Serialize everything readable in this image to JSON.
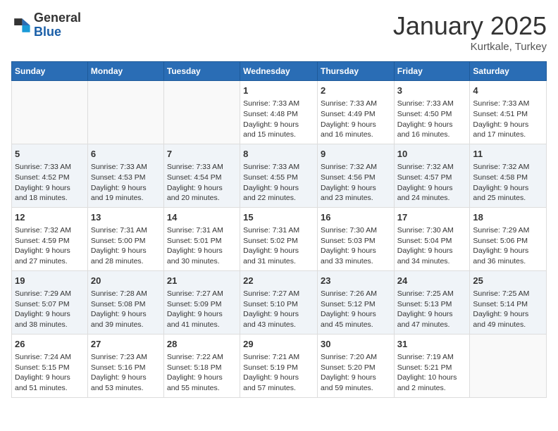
{
  "header": {
    "logo_general": "General",
    "logo_blue": "Blue",
    "month": "January 2025",
    "location": "Kurtkale, Turkey"
  },
  "weekdays": [
    "Sunday",
    "Monday",
    "Tuesday",
    "Wednesday",
    "Thursday",
    "Friday",
    "Saturday"
  ],
  "weeks": [
    [
      {
        "day": "",
        "info": ""
      },
      {
        "day": "",
        "info": ""
      },
      {
        "day": "",
        "info": ""
      },
      {
        "day": "1",
        "info": "Sunrise: 7:33 AM\nSunset: 4:48 PM\nDaylight: 9 hours\nand 15 minutes."
      },
      {
        "day": "2",
        "info": "Sunrise: 7:33 AM\nSunset: 4:49 PM\nDaylight: 9 hours\nand 16 minutes."
      },
      {
        "day": "3",
        "info": "Sunrise: 7:33 AM\nSunset: 4:50 PM\nDaylight: 9 hours\nand 16 minutes."
      },
      {
        "day": "4",
        "info": "Sunrise: 7:33 AM\nSunset: 4:51 PM\nDaylight: 9 hours\nand 17 minutes."
      }
    ],
    [
      {
        "day": "5",
        "info": "Sunrise: 7:33 AM\nSunset: 4:52 PM\nDaylight: 9 hours\nand 18 minutes."
      },
      {
        "day": "6",
        "info": "Sunrise: 7:33 AM\nSunset: 4:53 PM\nDaylight: 9 hours\nand 19 minutes."
      },
      {
        "day": "7",
        "info": "Sunrise: 7:33 AM\nSunset: 4:54 PM\nDaylight: 9 hours\nand 20 minutes."
      },
      {
        "day": "8",
        "info": "Sunrise: 7:33 AM\nSunset: 4:55 PM\nDaylight: 9 hours\nand 22 minutes."
      },
      {
        "day": "9",
        "info": "Sunrise: 7:32 AM\nSunset: 4:56 PM\nDaylight: 9 hours\nand 23 minutes."
      },
      {
        "day": "10",
        "info": "Sunrise: 7:32 AM\nSunset: 4:57 PM\nDaylight: 9 hours\nand 24 minutes."
      },
      {
        "day": "11",
        "info": "Sunrise: 7:32 AM\nSunset: 4:58 PM\nDaylight: 9 hours\nand 25 minutes."
      }
    ],
    [
      {
        "day": "12",
        "info": "Sunrise: 7:32 AM\nSunset: 4:59 PM\nDaylight: 9 hours\nand 27 minutes."
      },
      {
        "day": "13",
        "info": "Sunrise: 7:31 AM\nSunset: 5:00 PM\nDaylight: 9 hours\nand 28 minutes."
      },
      {
        "day": "14",
        "info": "Sunrise: 7:31 AM\nSunset: 5:01 PM\nDaylight: 9 hours\nand 30 minutes."
      },
      {
        "day": "15",
        "info": "Sunrise: 7:31 AM\nSunset: 5:02 PM\nDaylight: 9 hours\nand 31 minutes."
      },
      {
        "day": "16",
        "info": "Sunrise: 7:30 AM\nSunset: 5:03 PM\nDaylight: 9 hours\nand 33 minutes."
      },
      {
        "day": "17",
        "info": "Sunrise: 7:30 AM\nSunset: 5:04 PM\nDaylight: 9 hours\nand 34 minutes."
      },
      {
        "day": "18",
        "info": "Sunrise: 7:29 AM\nSunset: 5:06 PM\nDaylight: 9 hours\nand 36 minutes."
      }
    ],
    [
      {
        "day": "19",
        "info": "Sunrise: 7:29 AM\nSunset: 5:07 PM\nDaylight: 9 hours\nand 38 minutes."
      },
      {
        "day": "20",
        "info": "Sunrise: 7:28 AM\nSunset: 5:08 PM\nDaylight: 9 hours\nand 39 minutes."
      },
      {
        "day": "21",
        "info": "Sunrise: 7:27 AM\nSunset: 5:09 PM\nDaylight: 9 hours\nand 41 minutes."
      },
      {
        "day": "22",
        "info": "Sunrise: 7:27 AM\nSunset: 5:10 PM\nDaylight: 9 hours\nand 43 minutes."
      },
      {
        "day": "23",
        "info": "Sunrise: 7:26 AM\nSunset: 5:12 PM\nDaylight: 9 hours\nand 45 minutes."
      },
      {
        "day": "24",
        "info": "Sunrise: 7:25 AM\nSunset: 5:13 PM\nDaylight: 9 hours\nand 47 minutes."
      },
      {
        "day": "25",
        "info": "Sunrise: 7:25 AM\nSunset: 5:14 PM\nDaylight: 9 hours\nand 49 minutes."
      }
    ],
    [
      {
        "day": "26",
        "info": "Sunrise: 7:24 AM\nSunset: 5:15 PM\nDaylight: 9 hours\nand 51 minutes."
      },
      {
        "day": "27",
        "info": "Sunrise: 7:23 AM\nSunset: 5:16 PM\nDaylight: 9 hours\nand 53 minutes."
      },
      {
        "day": "28",
        "info": "Sunrise: 7:22 AM\nSunset: 5:18 PM\nDaylight: 9 hours\nand 55 minutes."
      },
      {
        "day": "29",
        "info": "Sunrise: 7:21 AM\nSunset: 5:19 PM\nDaylight: 9 hours\nand 57 minutes."
      },
      {
        "day": "30",
        "info": "Sunrise: 7:20 AM\nSunset: 5:20 PM\nDaylight: 9 hours\nand 59 minutes."
      },
      {
        "day": "31",
        "info": "Sunrise: 7:19 AM\nSunset: 5:21 PM\nDaylight: 10 hours\nand 2 minutes."
      },
      {
        "day": "",
        "info": ""
      }
    ]
  ]
}
